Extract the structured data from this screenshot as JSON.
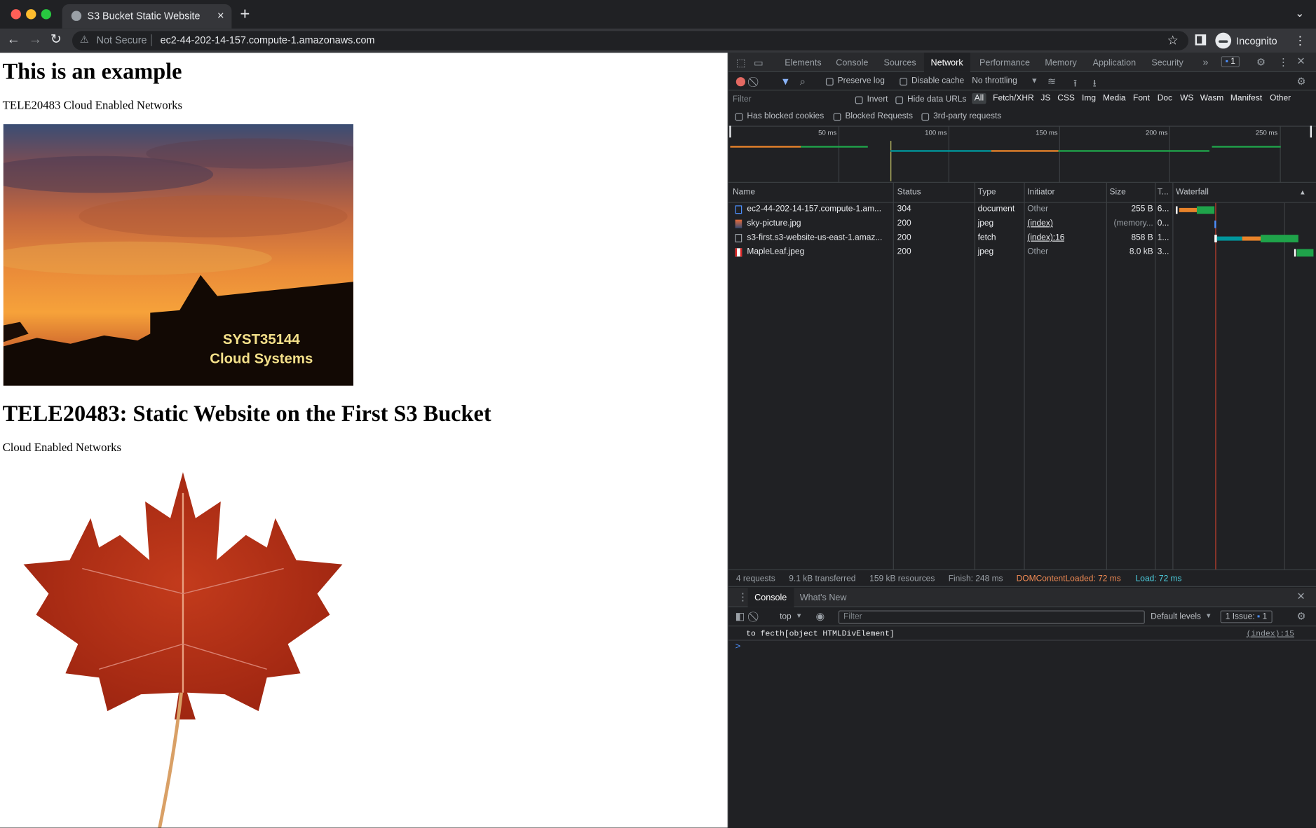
{
  "browser": {
    "tab_title": "S3 Bucket Static Website",
    "security_label": "Not Secure",
    "url": "ec2-44-202-14-157.compute-1.amazonaws.com",
    "profile_label": "Incognito"
  },
  "page": {
    "heading1": "This is an example",
    "text1": "TELE20483 Cloud Enabled Networks",
    "image1_caption_line1": "SYST35144",
    "image1_caption_line2": "Cloud Systems",
    "heading2": "TELE20483: Static Website on the First S3 Bucket",
    "text2": "Cloud Enabled Networks"
  },
  "devtools": {
    "tabs": [
      "Elements",
      "Console",
      "Sources",
      "Network",
      "Performance",
      "Memory",
      "Application",
      "Security"
    ],
    "active_tab": "Network",
    "issues_badge": "1",
    "toolbar": {
      "preserve_log": "Preserve log",
      "disable_cache": "Disable cache",
      "throttling": "No throttling"
    },
    "filter": {
      "placeholder": "Filter",
      "invert": "Invert",
      "hide_data_urls": "Hide data URLs",
      "types": [
        "All",
        "Fetch/XHR",
        "JS",
        "CSS",
        "Img",
        "Media",
        "Font",
        "Doc",
        "WS",
        "Wasm",
        "Manifest",
        "Other"
      ],
      "has_blocked_cookies": "Has blocked cookies",
      "blocked_requests": "Blocked Requests",
      "third_party": "3rd-party requests"
    },
    "timeline_ticks": [
      "50 ms",
      "100 ms",
      "150 ms",
      "200 ms",
      "250 ms"
    ],
    "columns": {
      "name": "Name",
      "status": "Status",
      "type": "Type",
      "initiator": "Initiator",
      "size": "Size",
      "time": "T...",
      "waterfall": "Waterfall"
    },
    "requests": [
      {
        "name": "ec2-44-202-14-157.compute-1.am...",
        "status": "304",
        "type": "document",
        "initiator": "Other",
        "size": "255 B",
        "time": "6..."
      },
      {
        "name": "sky-picture.jpg",
        "status": "200",
        "type": "jpeg",
        "initiator": "(index)",
        "size": "(memory...",
        "time": "0..."
      },
      {
        "name": "s3-first.s3-website-us-east-1.amaz...",
        "status": "200",
        "type": "fetch",
        "initiator": "(index):16",
        "size": "858 B",
        "time": "1..."
      },
      {
        "name": "MapleLeaf.jpeg",
        "status": "200",
        "type": "jpeg",
        "initiator": "Other",
        "size": "8.0 kB",
        "time": "3..."
      }
    ],
    "summary": {
      "requests": "4 requests",
      "transferred": "9.1 kB transferred",
      "resources": "159 kB resources",
      "finish": "Finish: 248 ms",
      "dom_content_loaded": "DOMContentLoaded: 72 ms",
      "load": "Load: 72 ms"
    },
    "drawer": {
      "tabs": [
        "Console",
        "What's New"
      ],
      "context": "top",
      "filter_placeholder": "Filter",
      "levels": "Default levels",
      "issues": "1 Issue:",
      "issues_count": "1",
      "log_message": "to fecth[object HTMLDivElement]",
      "log_source": "(index):15",
      "prompt": ">"
    }
  }
}
